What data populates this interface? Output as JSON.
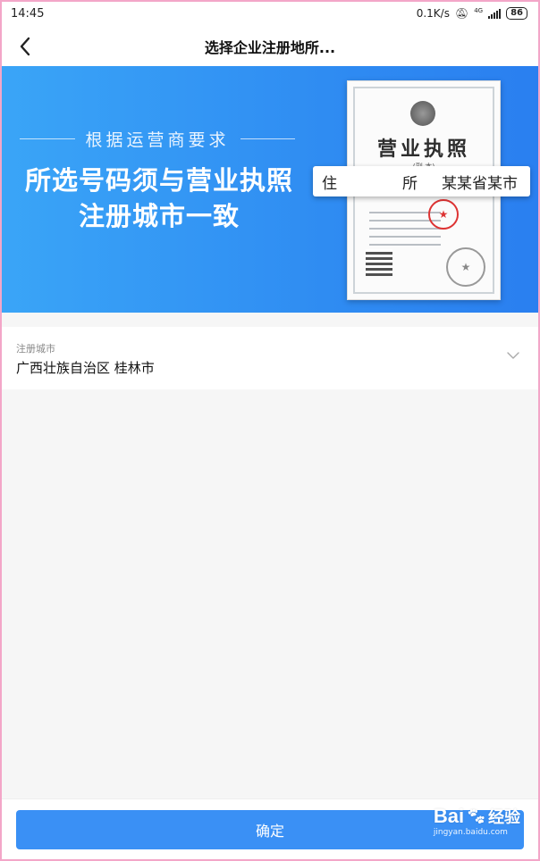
{
  "status_bar": {
    "time": "14:45",
    "network_speed": "0.1K/s",
    "network_type": "4G",
    "battery": "86",
    "icons": [
      "bell-off-icon",
      "signal-icon",
      "battery-icon"
    ]
  },
  "nav": {
    "back_icon": "chevron-left-icon",
    "title": "选择企业注册地所..."
  },
  "banner": {
    "subtitle": "根据运营商要求",
    "headline_line1": "所选号码须与营业执照",
    "headline_line2": "注册城市一致",
    "license": {
      "title": "营业执照",
      "subtitle": "(副 本)"
    },
    "address_card": {
      "label_char1": "住",
      "label_char2": "所",
      "value": "某某省某市"
    }
  },
  "city_selector": {
    "label": "注册城市",
    "value": "广西壮族自治区 桂林市",
    "icon": "chevron-down-icon"
  },
  "footer": {
    "confirm_label": "确定",
    "watermark_brand": "Bai",
    "watermark_suffix": "经验",
    "watermark_url": "jingyan.baidu.com"
  },
  "colors": {
    "accent": "#3a90f5",
    "banner_start": "#3aa5f7",
    "banner_end": "#2a7ff0",
    "seal_red": "#dd3333"
  }
}
